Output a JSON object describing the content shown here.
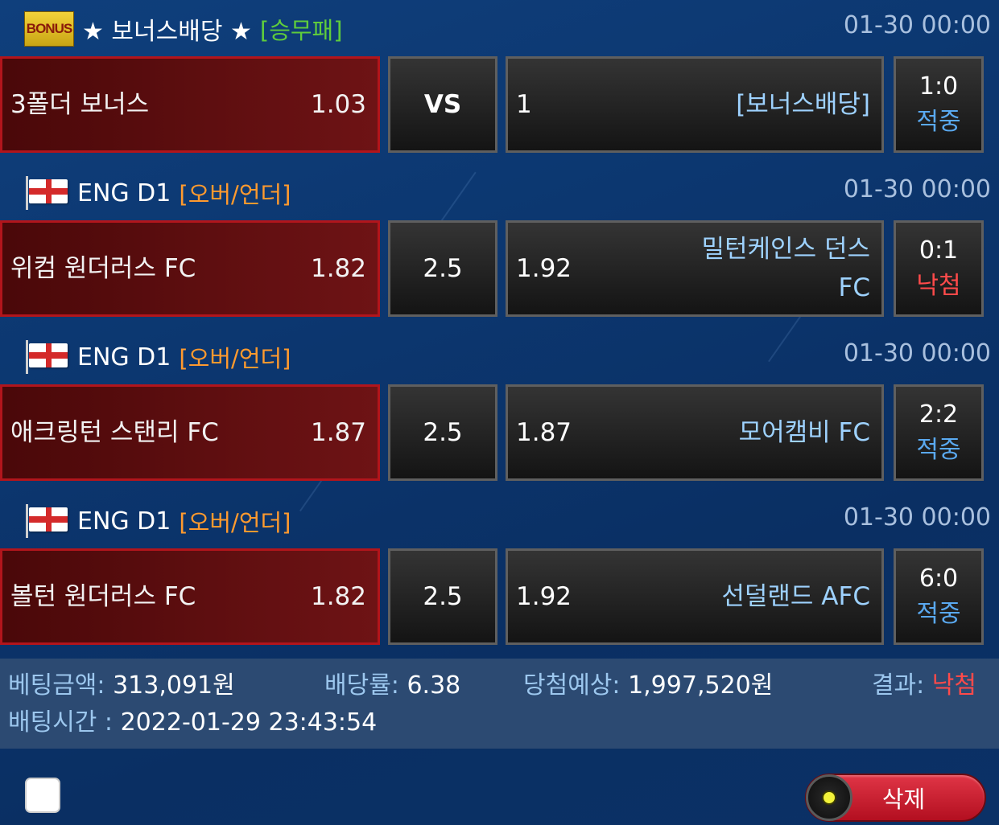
{
  "bets": [
    {
      "header": {
        "title": "★ 보너스배당 ★",
        "tag": "[승무패]",
        "datetime": "01-30 00:00",
        "icon": "bonus-badge-icon"
      },
      "home": {
        "name": "3폴더 보너스",
        "odds": "1.03"
      },
      "middle": "VS",
      "away": {
        "odds": "1",
        "name": "[보너스배당]"
      },
      "result": {
        "score": "1:0",
        "status": "적중"
      }
    },
    {
      "header": {
        "title": "ENG D1",
        "tag": "[오버/언더]",
        "datetime": "01-30 00:00",
        "icon": "england-flag-icon"
      },
      "home": {
        "name": "위컴 원더러스 FC",
        "odds": "1.82"
      },
      "middle": "2.5",
      "away": {
        "odds": "1.92",
        "name": "밀턴케인스 던스 FC"
      },
      "result": {
        "score": "0:1",
        "status": "낙첨"
      }
    },
    {
      "header": {
        "title": "ENG D1",
        "tag": "[오버/언더]",
        "datetime": "01-30 00:00",
        "icon": "england-flag-icon"
      },
      "home": {
        "name": "애크링턴 스탠리 FC",
        "odds": "1.87"
      },
      "middle": "2.5",
      "away": {
        "odds": "1.87",
        "name": "모어캠비 FC"
      },
      "result": {
        "score": "2:2",
        "status": "적중"
      }
    },
    {
      "header": {
        "title": "ENG D1",
        "tag": "[오버/언더]",
        "datetime": "01-30 00:00",
        "icon": "england-flag-icon"
      },
      "home": {
        "name": "볼턴 원더러스 FC",
        "odds": "1.82"
      },
      "middle": "2.5",
      "away": {
        "odds": "1.92",
        "name": "선덜랜드 AFC"
      },
      "result": {
        "score": "6:0",
        "status": "적중"
      }
    }
  ],
  "summary": {
    "amount_label": "베팅금액:",
    "amount_value": "313,091원",
    "rate_label": "배당률:",
    "rate_value": "6.38",
    "expected_label": "당첨예상:",
    "expected_value": "1,997,520원",
    "result_label": "결과:",
    "result_value": "낙첨",
    "time_label": "배팅시간 :",
    "time_value": "2022-01-29 23:43:54"
  },
  "actions": {
    "delete_label": "삭제",
    "checkbox_checked": false
  },
  "colors": {
    "win": "#5aa9f0",
    "lose": "#ff4a4a",
    "tag_green": "#5fcc3c",
    "tag_orange": "#ff9a2e"
  }
}
